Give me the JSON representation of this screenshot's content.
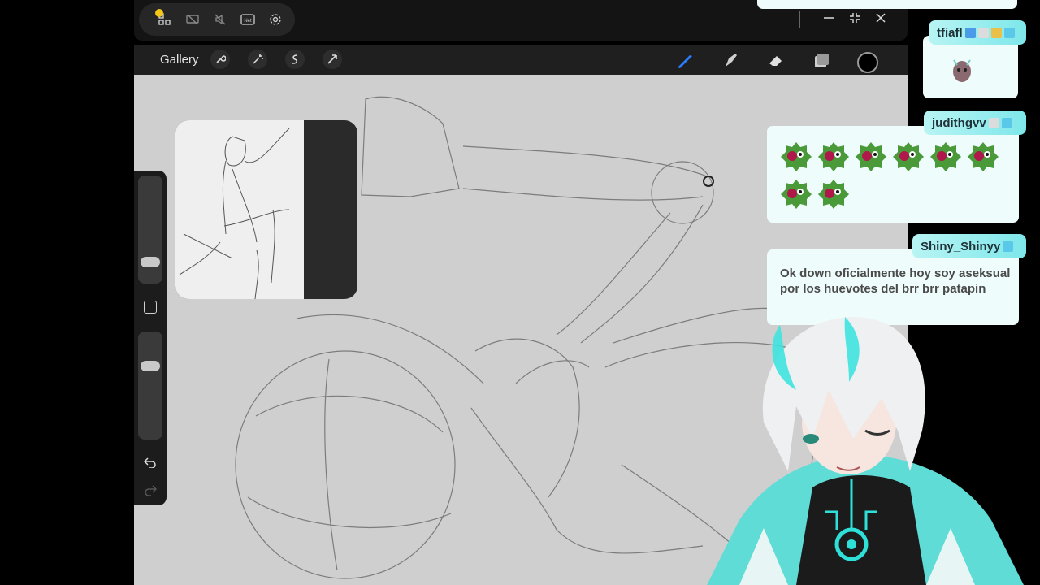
{
  "mirror_bar": {
    "icons": [
      "screenshot-icon",
      "screen-off-icon",
      "mute-icon",
      "network-icon",
      "settings-icon"
    ],
    "network_label": "Net",
    "window_controls": [
      "minimize-icon",
      "shrink-icon",
      "close-icon"
    ]
  },
  "procreate": {
    "gallery_label": "Gallery",
    "left_tools": [
      "wrench-icon",
      "magic-wand-icon",
      "selection-icon",
      "transform-icon"
    ],
    "right_tools": [
      "brush-icon",
      "smudge-icon",
      "eraser-icon",
      "layers-icon"
    ],
    "active_color": "#000000",
    "active_tool_color": "#2a7fff"
  },
  "chat": [
    {
      "user": "tfiafl",
      "badges": [
        "#4a9be8",
        "#dcdcdc",
        "#e8c04a",
        "#5ac8e8"
      ],
      "message": "",
      "emotes": 1
    },
    {
      "user": "judithgvv",
      "badges": [
        "#dcdcdc",
        "#5ac8e8"
      ],
      "message": "",
      "emotes": 8
    },
    {
      "user": "Shiny_Shinyy",
      "badges": [
        "#5ac8e8"
      ],
      "message": "Ok down oficialmente hoy soy aseksual por los huevotes del brr brr patapin",
      "emotes": 0
    }
  ],
  "colors": {
    "chat_bg": "#eefcfb",
    "chat_name": "#7ee7ea",
    "accent": "#2ee0d8"
  }
}
